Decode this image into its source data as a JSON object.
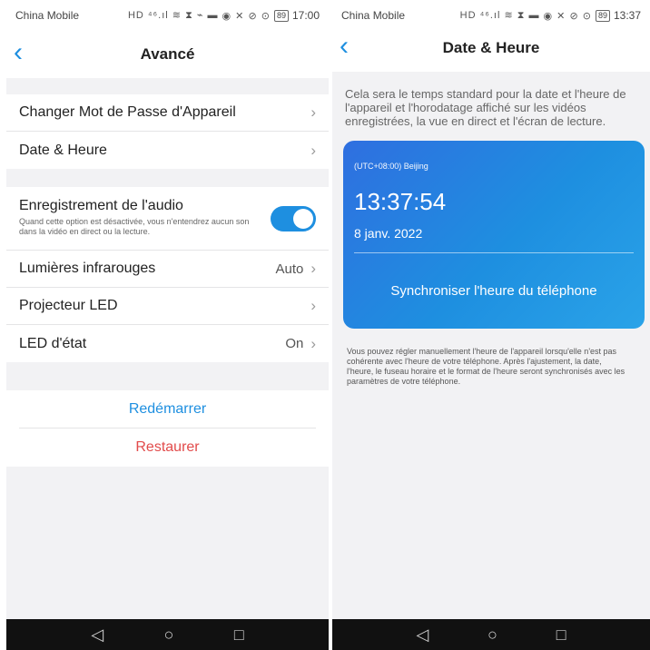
{
  "left": {
    "status": {
      "carrier": "China Mobile",
      "signal_icons": "HD ⁴⁶.ıl ≋ ⧗ ⌁ ▬",
      "right_icons": "◉ ✕ ⊘ ⊙",
      "battery": "89",
      "time": "17:00"
    },
    "title": "Avancé",
    "items_group1": [
      {
        "label": "Changer Mot de Passe d'Appareil",
        "value": ""
      },
      {
        "label": "Date & Heure",
        "value": ""
      }
    ],
    "audio": {
      "label": "Enregistrement de l'audio",
      "desc": "Quand cette option est désactivée, vous n'entendrez aucun son dans la vidéo en direct ou la lecture.",
      "enabled": true
    },
    "items_group2": [
      {
        "label": "Lumières infrarouges",
        "value": "Auto"
      },
      {
        "label": "Projecteur LED",
        "value": ""
      },
      {
        "label": "LED d'état",
        "value": "On"
      }
    ],
    "actions": {
      "restart": "Redémarrer",
      "restore": "Restaurer"
    },
    "colors": {
      "accent": "#1e8fe0",
      "danger": "#e24b4b"
    }
  },
  "right": {
    "status": {
      "carrier": "China Mobile",
      "signal_icons": "HD ⁴⁶.ıl ≋ ⧗ ▬",
      "right_icons": "◉ ✕ ⊘ ⊙",
      "battery": "89",
      "time": "13:37"
    },
    "title": "Date & Heure",
    "intro": "Cela sera le temps standard pour la date et l'heure de l'appareil et l'horodatage affiché sur les vidéos enregistrées, la vue en direct et l'écran de lecture.",
    "card": {
      "timezone": "(UTC+08:00) Beijing",
      "time": "13:37:54",
      "date": "8 janv. 2022",
      "sync": "Synchroniser l'heure du téléphone"
    },
    "note": "Vous pouvez régler manuellement l'heure de l'appareil lorsqu'elle n'est pas cohérente avec l'heure de votre téléphone. Après l'ajustement, la date, l'heure, le fuseau horaire et le format de l'heure seront synchronisés avec les paramètres de votre téléphone."
  },
  "icons": {
    "back": "chevron-left-icon",
    "chevron": "chevron-right-icon",
    "nav_back": "triangle-back-icon",
    "nav_home": "circle-home-icon",
    "nav_recent": "square-recent-icon"
  }
}
